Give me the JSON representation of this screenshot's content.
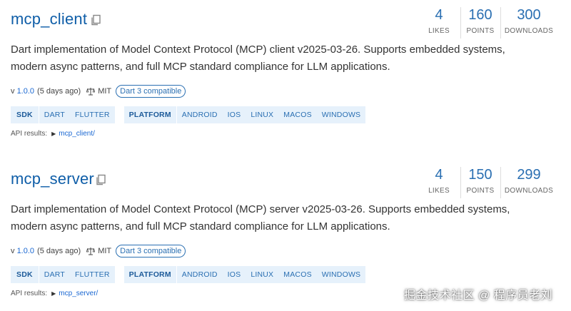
{
  "packages": [
    {
      "name": "mcp_client",
      "stats": [
        {
          "value": "4",
          "label": "LIKES"
        },
        {
          "value": "160",
          "label": "POINTS"
        },
        {
          "value": "300",
          "label": "DOWNLOADS"
        }
      ],
      "description": "Dart implementation of Model Context Protocol (MCP) client v2025-03-26. Supports embedded systems, modern async patterns, and full MCP standard compliance for LLM applications.",
      "version_prefix": "v",
      "version": "1.0.0",
      "published": "(5 days ago)",
      "license": "MIT",
      "compat_badge": "Dart 3 compatible",
      "sdk_group": {
        "head": "SDK",
        "tags": [
          "DART",
          "FLUTTER"
        ]
      },
      "platform_group": {
        "head": "PLATFORM",
        "tags": [
          "ANDROID",
          "IOS",
          "LINUX",
          "MACOS",
          "WINDOWS"
        ]
      },
      "api_label": "API results:",
      "api_link": "mcp_client/"
    },
    {
      "name": "mcp_server",
      "stats": [
        {
          "value": "4",
          "label": "LIKES"
        },
        {
          "value": "150",
          "label": "POINTS"
        },
        {
          "value": "299",
          "label": "DOWNLOADS"
        }
      ],
      "description": "Dart implementation of Model Context Protocol (MCP) server v2025-03-26. Supports embedded systems, modern async patterns, and full MCP standard compliance for LLM applications.",
      "version_prefix": "v",
      "version": "1.0.0",
      "published": "(5 days ago)",
      "license": "MIT",
      "compat_badge": "Dart 3 compatible",
      "sdk_group": {
        "head": "SDK",
        "tags": [
          "DART",
          "FLUTTER"
        ]
      },
      "platform_group": {
        "head": "PLATFORM",
        "tags": [
          "ANDROID",
          "IOS",
          "LINUX",
          "MACOS",
          "WINDOWS"
        ]
      },
      "api_label": "API results:",
      "api_link": "mcp_server/"
    }
  ],
  "icons": {
    "copy": "copy-icon",
    "license": "scale-icon",
    "expand": "triangle-right-icon"
  },
  "colors": {
    "title": "#0f5ea8",
    "stat": "#2a6fb2",
    "tag_bg": "#e6f1fb",
    "link": "#1967d2"
  },
  "watermark": "掘金技术社区 @ 程序员老刘"
}
